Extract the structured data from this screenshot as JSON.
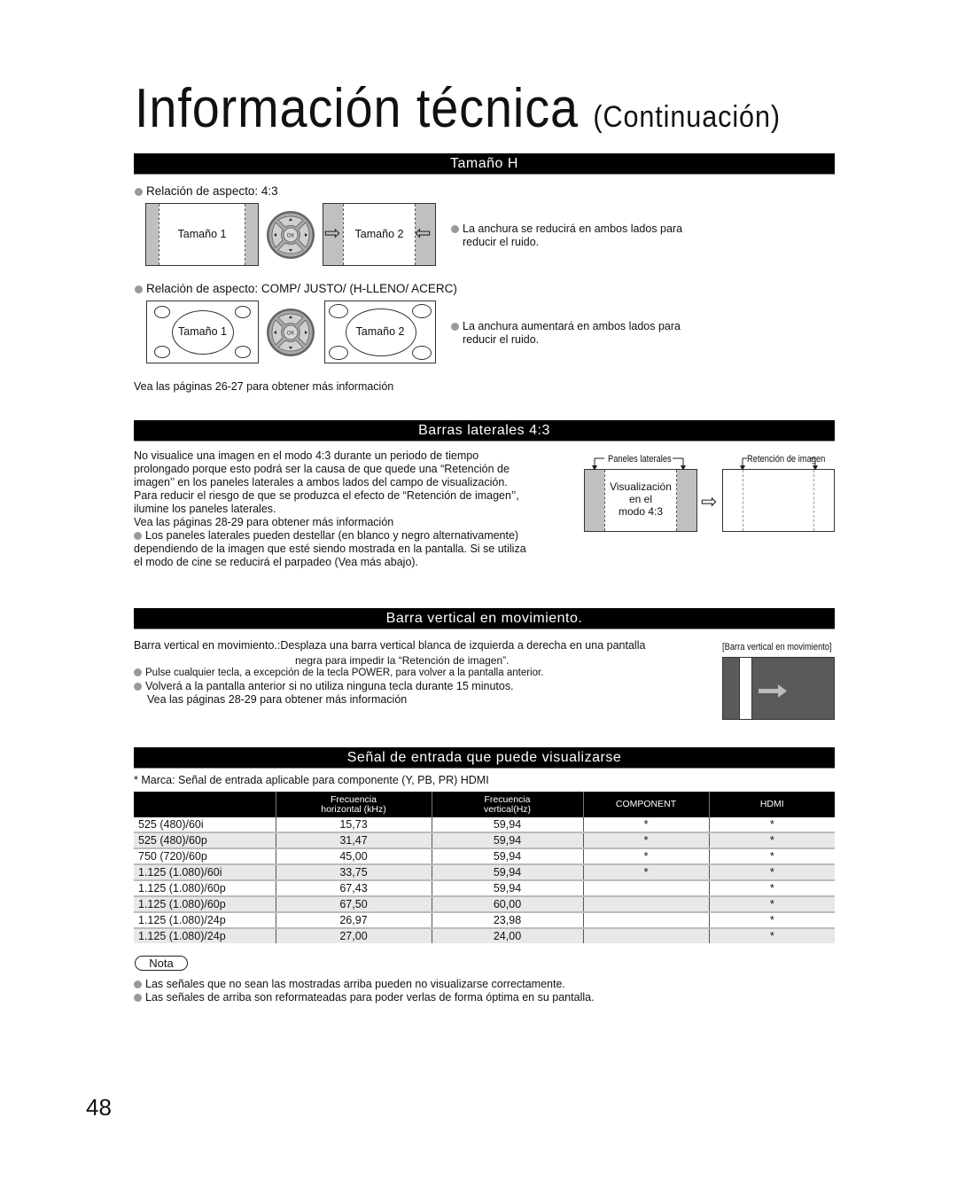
{
  "page": {
    "title": "Información técnica",
    "title_suffix": "(Continuación)",
    "page_number": "48"
  },
  "tamano_h": {
    "heading": "Tamaño H",
    "aspect_43": {
      "label": "Relación de aspecto: 4:3",
      "screen1": "Tamaño 1",
      "screen2": "Tamaño 2",
      "note_line1": "La anchura se reducirá en ambos lados para",
      "note_line2": "reducir el ruido."
    },
    "aspect_comp": {
      "label": "Relación de aspecto:  COMP/ JUSTO/ (H-LLENO/ ACERC)",
      "screen1": "Tamaño 1",
      "screen2": "Tamaño 2",
      "note_line1": "La anchura aumentará en ambos lados para",
      "note_line2": "reducir el ruido."
    },
    "see_pages": "Vea las páginas 26-27 para obtener más información",
    "remote_ok": "OK"
  },
  "barras_laterales": {
    "heading": "Barras laterales 4:3",
    "paragraph": [
      "No visualice una imagen en el modo 4:3 durante un periodo de tiempo",
      "prolongado porque esto podrá ser la causa de que quede una “Retención de",
      "imagen’’ en los paneles laterales a ambos lados del campo de visualización.",
      "Para reducir el riesgo de que se produzca el  efecto de “Retención de imagen’’,",
      "ilumine los paneles laterales.",
      "Vea las páginas 28-29 para obtener más información"
    ],
    "bullet": [
      "Los paneles laterales pueden destellar (en blanco y negro alternativamente)",
      "dependiendo de la imagen que esté siendo mostrada en la pantalla. Si se utiliza",
      "el modo de cine se reducirá el parpadeo (Vea más abajo)."
    ],
    "diagram": {
      "side_panels_label": "Paneles laterales",
      "display_line1": "Visualización",
      "display_line2": "en el",
      "display_line3": "modo 4:3",
      "retention_label": "Retención de imagen"
    }
  },
  "barra_vertical": {
    "heading": "Barra vertical en movimiento.",
    "desc_line1": "Barra vertical en movimiento.:Desplaza una barra vertical blanca de izquierda a derecha en una pantalla",
    "desc_line2": "negra para impedir la “Retención de imagen”.",
    "bullet1": "Pulse cualquier tecla, a excepción de la tecla POWER, para volver a la pantalla anterior.",
    "bullet2": "Volverá a la pantalla anterior si no utiliza ninguna tecla durante 15 minutos.",
    "see_pages": "Vea las páginas 28-29 para obtener más información",
    "diagram_label": "[Barra vertical en movimiento]"
  },
  "senal_entrada": {
    "heading": "Señal de entrada que puede visualizarse",
    "mark_note": "* Marca:  Señal de entrada aplicable para componente (Y, PB, PR) HDMI",
    "columns": [
      "",
      "Frecuencia\nhorizontal (kHz)",
      "Frecuencia\nvertical(Hz)",
      "COMPONENT",
      "HDMI"
    ],
    "col_h_line1": "Frecuencia",
    "col_h_line2": "horizontal (kHz)",
    "col_v_line1": "Frecuencia",
    "col_v_line2": "vertical(Hz)",
    "col_component": "COMPONENT",
    "col_hdmi": "HDMI",
    "rows": [
      {
        "signal": "525 (480)/60i",
        "h": "15,73",
        "v": "59,94",
        "component": "*",
        "hdmi": "*"
      },
      {
        "signal": "525 (480)/60p",
        "h": "31,47",
        "v": "59,94",
        "component": "*",
        "hdmi": "*"
      },
      {
        "signal": "750 (720)/60p",
        "h": "45,00",
        "v": "59,94",
        "component": "*",
        "hdmi": "*"
      },
      {
        "signal": "1.125 (1.080)/60i",
        "h": "33,75",
        "v": "59,94",
        "component": "*",
        "hdmi": "*"
      },
      {
        "signal": "1.125 (1.080)/60p",
        "h": "67,43",
        "v": "59,94",
        "component": "",
        "hdmi": "*"
      },
      {
        "signal": "1.125 (1.080)/60p",
        "h": "67,50",
        "v": "60,00",
        "component": "",
        "hdmi": "*"
      },
      {
        "signal": "1.125 (1.080)/24p",
        "h": "26,97",
        "v": "23,98",
        "component": "",
        "hdmi": "*"
      },
      {
        "signal": "1.125 (1.080)/24p",
        "h": "27,00",
        "v": "24,00",
        "component": "",
        "hdmi": "*"
      }
    ]
  },
  "nota": {
    "label": "Nota",
    "bullet1": "Las señales que no sean las mostradas arriba pueden no visualizarse correctamente.",
    "bullet2": "Las señales de arriba son reformateadas para poder verlas de forma óptima en su pantalla."
  }
}
